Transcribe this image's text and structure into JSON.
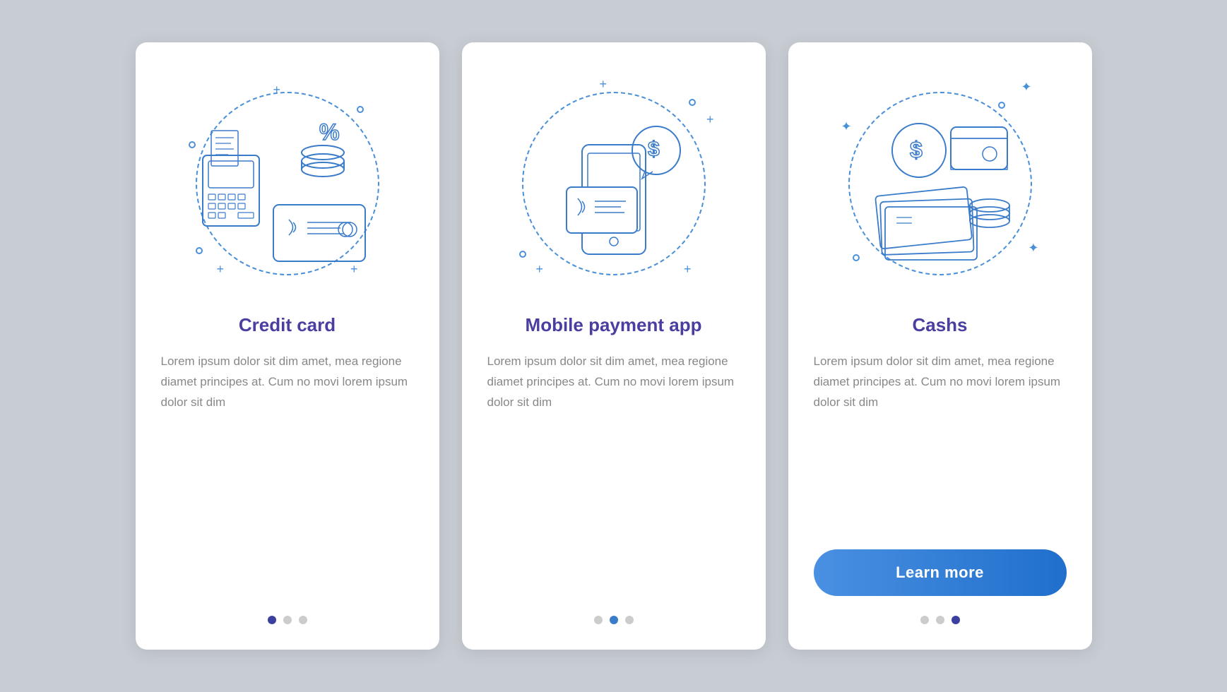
{
  "cards": [
    {
      "id": "credit-card",
      "title": "Credit card",
      "body": "Lorem ipsum dolor sit dim amet, mea regione diamet principes at. Cum no movi lorem ipsum dolor sit dim",
      "dots": [
        "active",
        "inactive",
        "inactive"
      ],
      "show_button": false,
      "button_label": ""
    },
    {
      "id": "mobile-payment",
      "title": "Mobile\npayment app",
      "body": "Lorem ipsum dolor sit dim amet, mea regione diamet principes at. Cum no movi lorem ipsum dolor sit dim",
      "dots": [
        "inactive",
        "active-mid",
        "inactive"
      ],
      "show_button": false,
      "button_label": ""
    },
    {
      "id": "cashs",
      "title": "Cashs",
      "body": "Lorem ipsum dolor sit dim amet, mea regione diamet principes at. Cum no movi lorem ipsum dolor sit dim",
      "dots": [
        "inactive",
        "inactive",
        "active"
      ],
      "show_button": true,
      "button_label": "Learn more"
    }
  ]
}
